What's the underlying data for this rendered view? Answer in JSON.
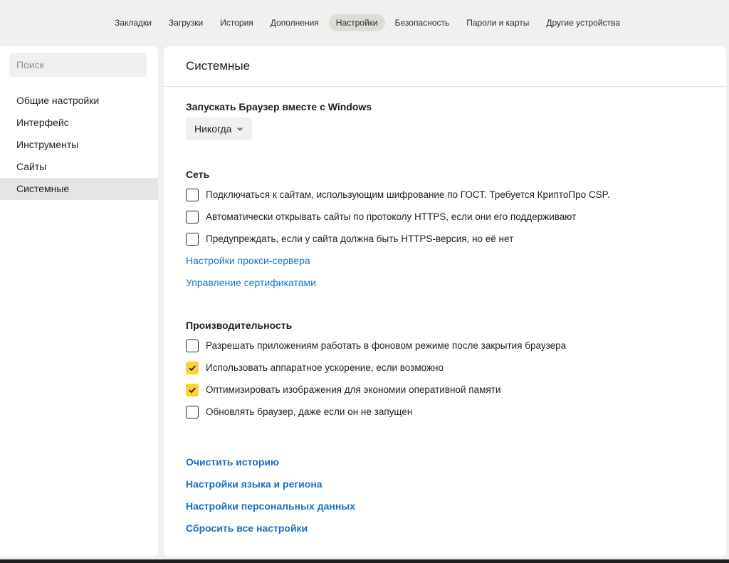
{
  "topnav": {
    "tabs": [
      {
        "label": "Закладки",
        "active": false
      },
      {
        "label": "Загрузки",
        "active": false
      },
      {
        "label": "История",
        "active": false
      },
      {
        "label": "Дополнения",
        "active": false
      },
      {
        "label": "Настройки",
        "active": true
      },
      {
        "label": "Безопасность",
        "active": false
      },
      {
        "label": "Пароли и карты",
        "active": false
      },
      {
        "label": "Другие устройства",
        "active": false
      }
    ]
  },
  "sidebar": {
    "search_placeholder": "Поиск",
    "items": [
      {
        "label": "Общие настройки",
        "active": false
      },
      {
        "label": "Интерфейс",
        "active": false
      },
      {
        "label": "Инструменты",
        "active": false
      },
      {
        "label": "Сайты",
        "active": false
      },
      {
        "label": "Системные",
        "active": true
      }
    ]
  },
  "main": {
    "title": "Системные",
    "startup": {
      "title": "Запускать Браузер вместе с Windows",
      "dropdown_value": "Никогда",
      "dropdown_icon": "chevron-down-icon"
    },
    "network": {
      "title": "Сеть",
      "options": [
        {
          "label": "Подключаться к сайтам, использующим шифрование по ГОСТ. Требуется КриптоПро CSP.",
          "checked": false
        },
        {
          "label": "Автоматически открывать сайты по протоколу HTTPS, если они его поддерживают",
          "checked": false
        },
        {
          "label": "Предупреждать, если у сайта должна быть HTTPS-версия, но её нет",
          "checked": false
        }
      ],
      "links": [
        "Настройки прокси-сервера",
        "Управление сертификатами"
      ]
    },
    "performance": {
      "title": "Производительность",
      "options": [
        {
          "label": "Разрешать приложениям работать в фоновом режиме после закрытия браузера",
          "checked": false
        },
        {
          "label": "Использовать аппаратное ускорение, если возможно",
          "checked": true
        },
        {
          "label": "Оптимизировать изображения для экономии оперативной памяти",
          "checked": true
        },
        {
          "label": "Обновлять браузер, даже если он не запущен",
          "checked": false
        }
      ]
    },
    "bottom_links": [
      "Очистить историю",
      "Настройки языка и региона",
      "Настройки персональных данных",
      "Сбросить все настройки"
    ]
  },
  "colors": {
    "accent_checkbox": "#fdd331",
    "link": "#1a75c6",
    "page_bg": "#f1f0ee"
  }
}
